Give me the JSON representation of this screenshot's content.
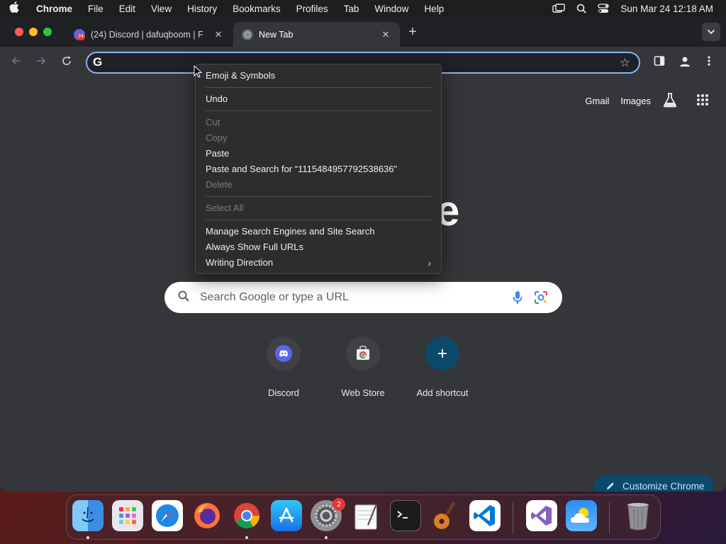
{
  "menubar": {
    "app_name": "Chrome",
    "items": [
      "File",
      "Edit",
      "View",
      "History",
      "Bookmarks",
      "Profiles",
      "Tab",
      "Window",
      "Help"
    ],
    "clock": "Sun Mar 24  12:18 AM"
  },
  "tabs": [
    {
      "title": "(24) Discord | dafuqboom | F",
      "badge": "24",
      "active": false
    },
    {
      "title": "New Tab",
      "active": true
    }
  ],
  "omnibox": {
    "value": "",
    "icon": "google-g"
  },
  "ntp": {
    "links": [
      "Gmail",
      "Images"
    ],
    "logo_fragment": "e",
    "search_placeholder": "Search Google or type a URL",
    "shortcuts": [
      {
        "label": "Discord",
        "icon": "discord-icon"
      },
      {
        "label": "Web Store",
        "icon": "webstore-icon"
      },
      {
        "label": "Add shortcut",
        "icon": "plus-icon"
      }
    ],
    "customize_label": "Customize Chrome"
  },
  "context_menu": {
    "emoji": "Emoji & Symbols",
    "undo": "Undo",
    "cut": "Cut",
    "copy": "Copy",
    "paste": "Paste",
    "paste_search": "Paste and Search for “1115484957792538636”",
    "delete": "Delete",
    "select_all": "Select All",
    "manage_engines": "Manage Search Engines and Site Search",
    "show_urls": "Always Show Full URLs",
    "writing_direction": "Writing Direction"
  },
  "dock": {
    "apps": [
      "Finder",
      "Launchpad",
      "Safari",
      "Firefox",
      "Chrome",
      "App Store",
      "System Settings",
      "TextEdit",
      "Terminal",
      "GarageBand",
      "Visual Studio Code",
      "Visual Studio",
      "Weather",
      "Trash"
    ],
    "settings_badge": "2"
  },
  "colors": {
    "accent": "#8ab4f8",
    "discord": "#5865f2",
    "customize_bg": "#0b4a6b"
  }
}
